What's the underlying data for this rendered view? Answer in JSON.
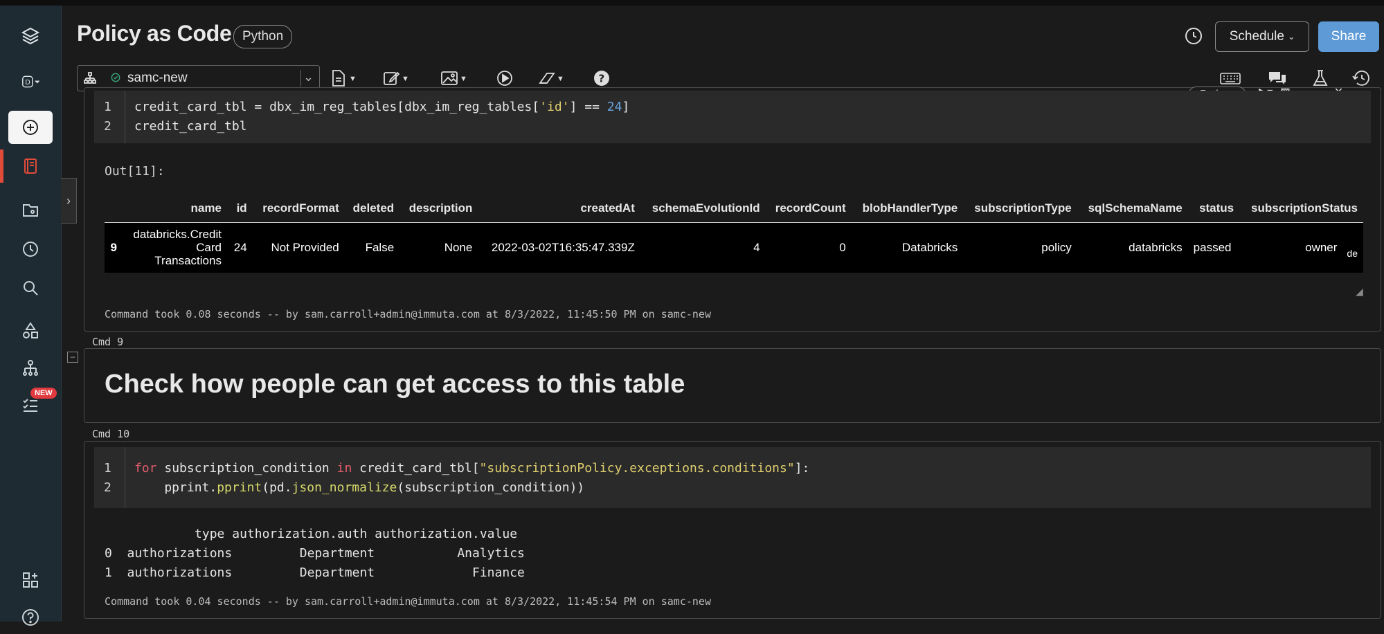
{
  "header": {
    "title": "Policy as Code",
    "language": "Python",
    "schedule_label": "Schedule",
    "share_label": "Share"
  },
  "toolbar": {
    "cluster_name": "samc-new"
  },
  "sidebar": {
    "new_badge": "NEW"
  },
  "cell1": {
    "lang_pill": "Python",
    "line_numbers": [
      "1",
      "2"
    ],
    "code_line1_a": "credit_card_tbl = dbx_im_reg_tables[dbx_im_reg_tables[",
    "code_line1_str": "'id'",
    "code_line1_b": "] == ",
    "code_line1_num": "24",
    "code_line1_c": "]",
    "code_line2": "credit_card_tbl",
    "out_label": "Out[11]:",
    "table": {
      "columns": [
        "",
        "name",
        "id",
        "recordFormat",
        "deleted",
        "description",
        "createdAt",
        "schemaEvolutionId",
        "recordCount",
        "blobHandlerType",
        "subscriptionType",
        "sqlSchemaName",
        "status",
        "subscriptionStatus"
      ],
      "row": {
        "index": "9",
        "name_l1": "databricks.Credit",
        "name_l2": "Card",
        "name_l3": "Transactions",
        "id": "24",
        "recordFormat": "Not Provided",
        "deleted": "False",
        "description": "None",
        "createdAt": "2022-03-02T16:35:47.339Z",
        "schemaEvolutionId": "4",
        "recordCount": "0",
        "blobHandlerType": "Databricks",
        "subscriptionType": "policy",
        "sqlSchemaName": "databricks",
        "status": "passed",
        "subscriptionStatus": "owner",
        "overflow": "de"
      }
    },
    "command_took": "Command took 0.08 seconds -- by sam.carroll+admin@immuta.com at 8/3/2022, 11:45:50 PM on samc-new"
  },
  "cell2": {
    "cmd_label": "Cmd 9",
    "heading": "Check how people can get access to this table"
  },
  "cell3": {
    "cmd_label": "Cmd 10",
    "line_numbers": [
      "1",
      "2"
    ],
    "kw_for": "for",
    "var": " subscription_condition ",
    "kw_in": "in",
    "rest1": " credit_card_tbl[",
    "str1": "\"subscriptionPolicy.exceptions.conditions\"",
    "rest1b": "]:",
    "indent": "    pprint.",
    "fn_pprint": "pprint",
    "mid": "(pd.",
    "fn_norm": "json_normalize",
    "tail": "(subscription_condition))",
    "output_lines": [
      "            type authorization.auth authorization.value",
      "0  authorizations         Department           Analytics",
      "1  authorizations         Department             Finance"
    ],
    "command_took": "Command took 0.04 seconds -- by sam.carroll+admin@immuta.com at 8/3/2022, 11:45:54 PM on samc-new"
  }
}
